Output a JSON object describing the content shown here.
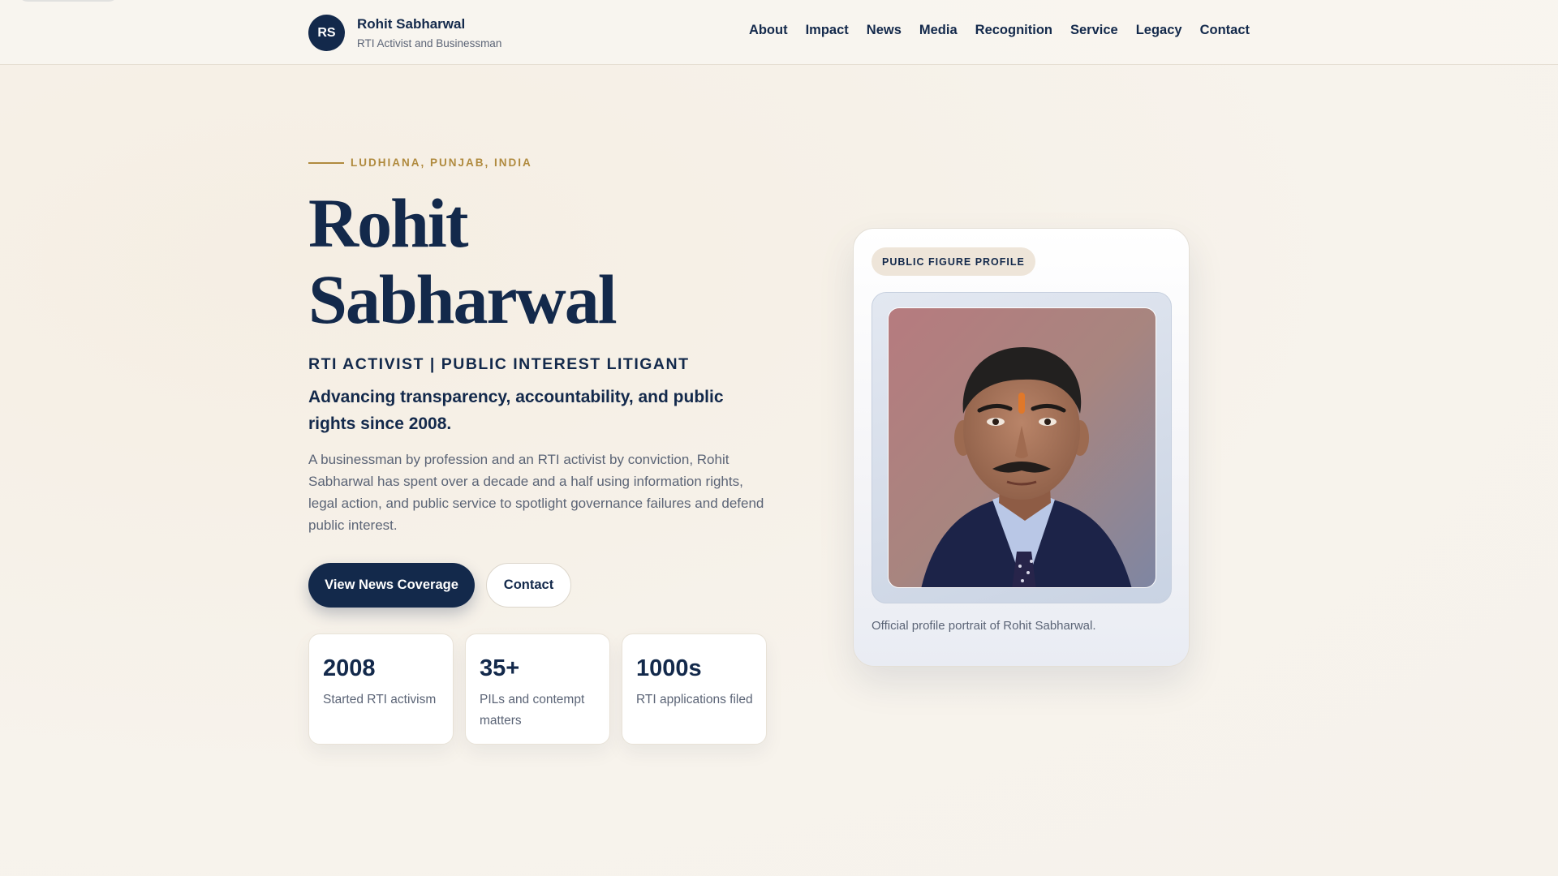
{
  "header": {
    "avatar_initials": "RS",
    "brand_name": "Rohit Sabharwal",
    "brand_subtitle": "RTI Activist and Businessman",
    "nav": [
      "About",
      "Impact",
      "News",
      "Media",
      "Recognition",
      "Service",
      "Legacy",
      "Contact"
    ]
  },
  "hero": {
    "eyebrow": "LUDHIANA, PUNJAB, INDIA",
    "title_line1": "Rohit",
    "title_line2": "Sabharwal",
    "role": "RTI ACTIVIST | PUBLIC INTEREST LITIGANT",
    "tagline": "Advancing transparency, accountability, and public rights since 2008.",
    "description": "A businessman by profession and an RTI activist by conviction, Rohit Sabharwal has spent over a decade and a half using information rights, legal action, and public service to spotlight governance failures and defend public interest.",
    "primary_button": "View News Coverage",
    "secondary_button": "Contact"
  },
  "stats": [
    {
      "value": "2008",
      "label": "Started RTI activism"
    },
    {
      "value": "35+",
      "label": "PILs and contempt matters"
    },
    {
      "value": "1000s",
      "label": "RTI applications filed"
    }
  ],
  "profile_card": {
    "badge": "PUBLIC FIGURE PROFILE",
    "caption": "Official profile portrait of Rohit Sabharwal."
  },
  "colors": {
    "navy": "#13294b",
    "gold": "#b08a3e",
    "muted": "#5b6476",
    "background": "#f6f1e8"
  }
}
